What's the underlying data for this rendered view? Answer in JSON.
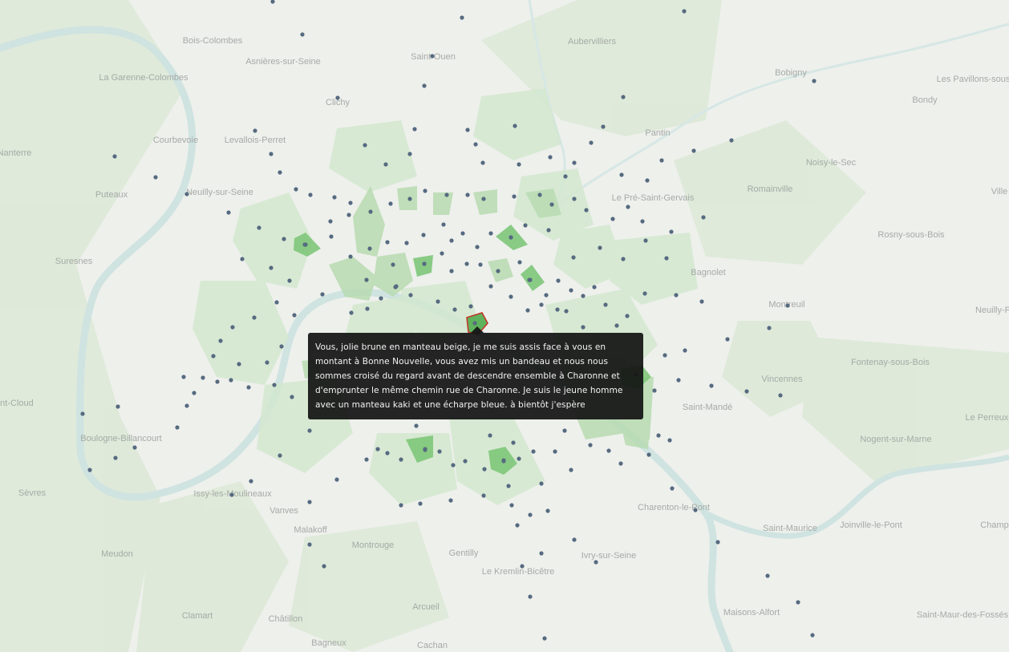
{
  "map": {
    "tooltip_text": "Vous, jolie brune en manteau beige, je me suis assis face à vous en montant à Bonne Nouvelle, vous avez mis un bandeau et nous nous sommes croisé du regard avant de descendre ensemble à Charonne et d'emprunter le même chemin rue de Charonne. Je suis le jeune homme avec un manteau kaki et une écharpe bleue. à bientôt j'espère",
    "colors": {
      "water": "#cfe3e1",
      "zone_light": "#d7ead3",
      "zone_mid": "#b9dcb2",
      "zone_strong": "#6fbf6a",
      "selected_outline": "#c0392b",
      "station_dot": "#566a80"
    },
    "place_labels": [
      "Bois-Colombes",
      "Asnières-sur-Seine",
      "Saint-Ouen",
      "Aubervilliers",
      "Bobigny",
      "Les Pavillons-sous-Bois",
      "La Garenne-Colombes",
      "Clichy",
      "Bondy",
      "Courbevoie",
      "Levallois-Perret",
      "Pantin",
      "Noisy-le-Sec",
      "Nanterre",
      "Puteaux",
      "Neuilly-sur-Seine",
      "Le Pré-Saint-Gervais",
      "Romainville",
      "Ville",
      "Rosny-sous-Bois",
      "Suresnes",
      "Bagnolet",
      "Montreuil",
      "Neuilly-P",
      "Fontenay-sous-Bois",
      "Vincennes",
      "Saint-Mandé",
      "Saint-Cloud",
      "Boulogne-Billancourt",
      "Nogent-sur-Marne",
      "Le Perreux-s",
      "Sèvres",
      "Issy-les-Moulineaux",
      "Vanves",
      "Charenton-le-Pont",
      "Saint-Maurice",
      "Joinville-le-Pont",
      "Champ",
      "Malakoff",
      "Montrouge",
      "Gentilly",
      "Le Kremlin-Bicêtre",
      "Ivry-sur-Seine",
      "Meudon",
      "Arcueil",
      "Maisons-Alfort",
      "Saint-Maur-des-Fossés",
      "Clamart",
      "Châtillon",
      "Bagneux",
      "Cachan"
    ]
  }
}
